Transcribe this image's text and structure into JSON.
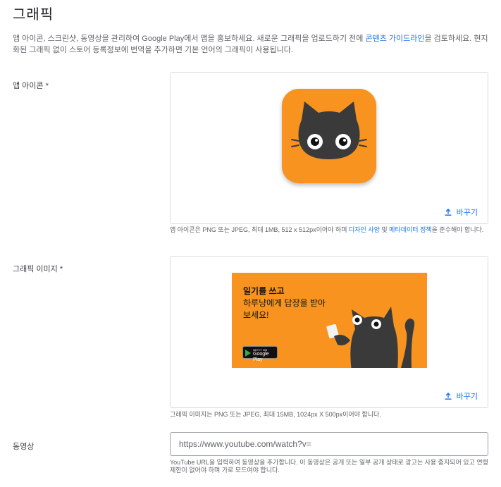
{
  "header": {
    "title": "그래픽",
    "description_1": "앱 아이콘, 스크린샷, 동영상을 관리하여 Google Play에서 앱을 홍보하세요. 새로운 그래픽을 업로드하기 전에 ",
    "description_link": "콘텐츠 가이드라인",
    "description_2": "을 검토하세요. 현지화된 그래픽 없이 스토어 등록정보에 번역을 추가하면 기본 언어의 그래픽이 사용됩니다."
  },
  "app_icon": {
    "label": "앱 아이콘 *",
    "change_label": "바꾸기",
    "help_1": "앱 아이콘은 PNG 또는 JPEG, 최대 1MB, 512 x 512px이어야 하며 ",
    "help_link_1": "디자인 사양",
    "help_mid": " 및 ",
    "help_link_2": "메타데이터 정책",
    "help_2": "을 준수해야 합니다."
  },
  "feature_graphic": {
    "label": "그래픽 이미지 *",
    "change_label": "바꾸기",
    "headline": "일기를 쓰고",
    "subline": "하루냥에게 답장을 받아보세요!",
    "badge_small": "GET IT ON",
    "badge_large": "Google Play",
    "help": "그래픽 이미지는 PNG 또는 JPEG, 최대 15MB, 1024px X 500px이어야 합니다."
  },
  "video": {
    "label": "동영상",
    "placeholder": "https://www.youtube.com/watch?v=",
    "help": "YouTube URL을 입력하여 동영상을 추가합니다. 이 동영상은 공개 또는 일부 공개 상태로 광고는 사용 중지되어 있고 연령 제한이 없어야 하며 가로 모드여야 합니다."
  },
  "icons": [
    "upload-icon",
    "cat-icon"
  ],
  "colors": {
    "accent": "#1a73e8",
    "brand_orange": "#f7931e",
    "cat": "#3a3a3a"
  }
}
